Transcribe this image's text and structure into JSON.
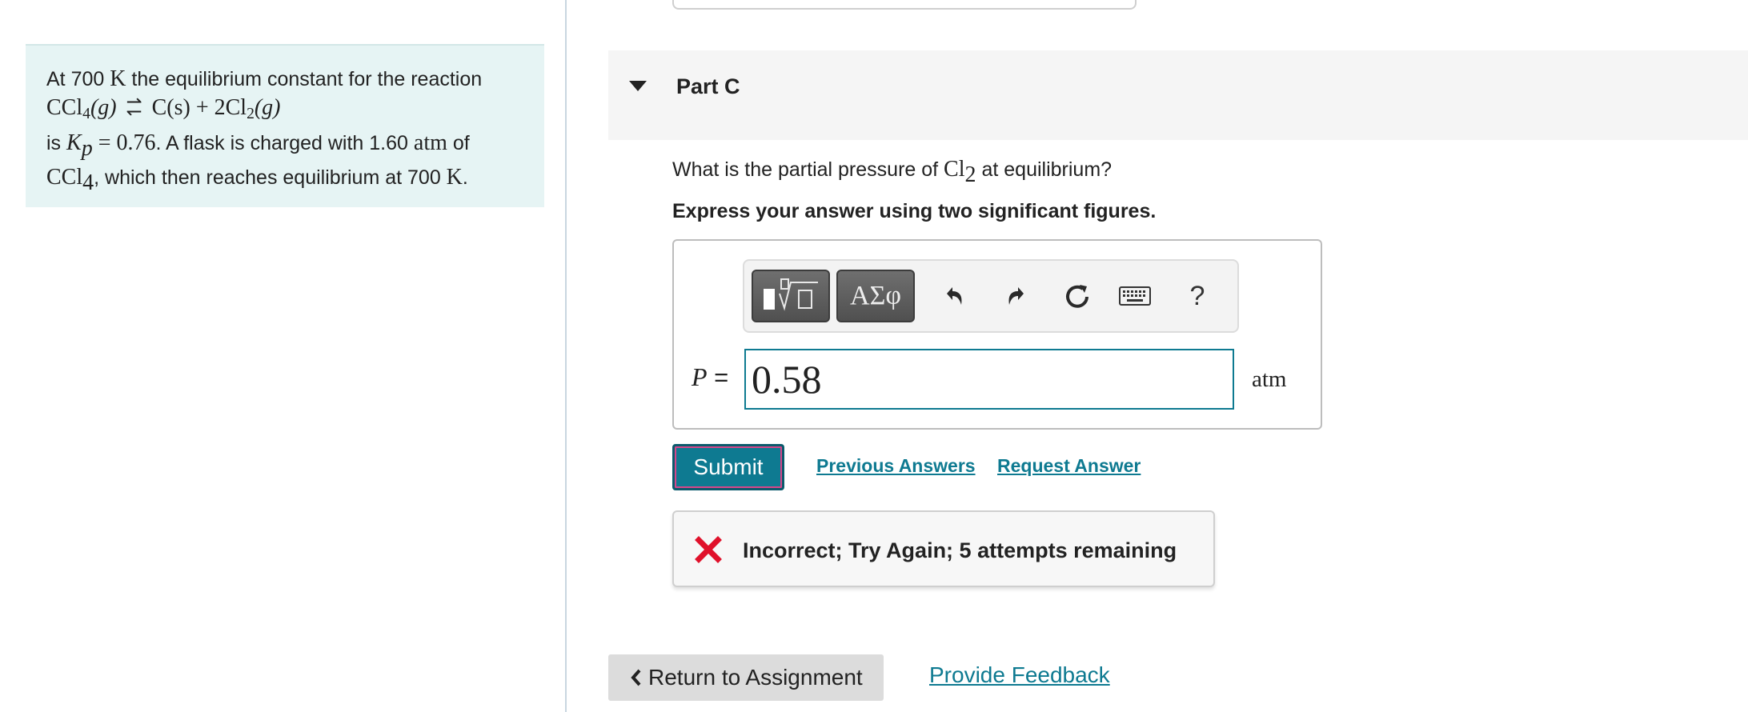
{
  "problem": {
    "line1_pre": "At 700 ",
    "line1_K": "K",
    "line1_post": " the equilibrium constant for the reaction",
    "reaction": {
      "reactant": "CCl",
      "reactant_sub": "4",
      "reactant_phase": "(g)",
      "product1": "C(s) + 2Cl",
      "product1_sub": "2",
      "product2_phase": "(g)"
    },
    "line3_pre": "is ",
    "kp_symbol": "K",
    "kp_sub": "p",
    "kp_value": " = 0.76",
    "line3_post": ". A flask is charged with 1.60 ",
    "atm": "atm",
    "line3_end": " of",
    "line4_species": "CCl",
    "line4_sub": "4",
    "line4_post": ", which then reaches equilibrium at 700 ",
    "line4_K": "K",
    "line4_end": "."
  },
  "part": {
    "title": "Part C"
  },
  "question": {
    "pre": "What is the partial pressure of ",
    "species": "Cl",
    "species_sub": "2",
    "post": " at equilibrium?"
  },
  "instruction": "Express your answer using two significant figures.",
  "toolbar": {
    "greek_label": "ΑΣφ",
    "help_label": "?"
  },
  "answer": {
    "variable": "P",
    "equals": " =",
    "value": "0.58",
    "unit": "atm"
  },
  "actions": {
    "submit_label": "Submit",
    "previous_answers_label": "Previous Answers",
    "request_answer_label": "Request Answer"
  },
  "feedback": {
    "message": "Incorrect; Try Again; 5 attempts remaining",
    "status_color": "#e0112b"
  },
  "footer": {
    "return_label": "Return to Assignment",
    "provide_feedback_label": "Provide Feedback"
  },
  "colors": {
    "accent": "#0e7a91",
    "problem_bg": "#e6f4f4"
  }
}
